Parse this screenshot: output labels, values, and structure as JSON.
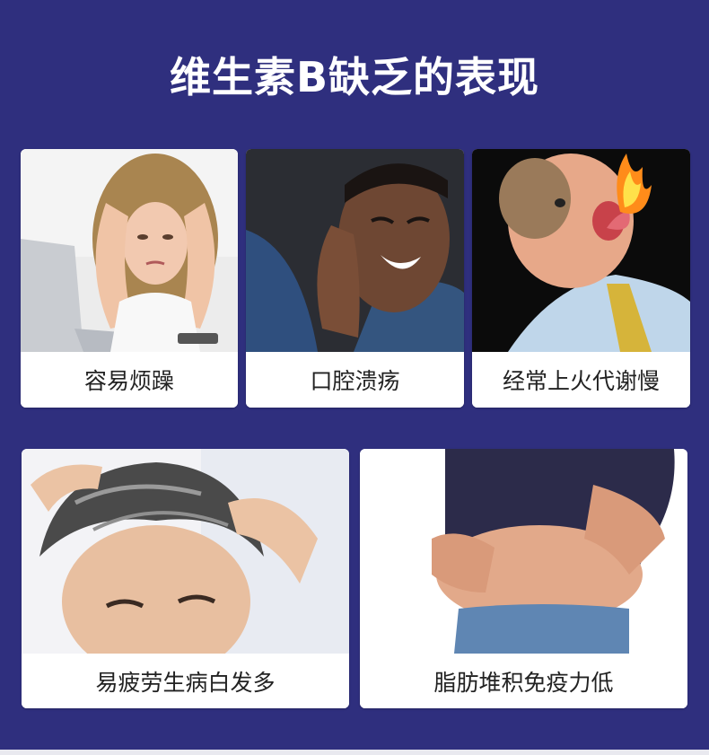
{
  "title": "维生素B缺乏的表现",
  "cards": [
    {
      "caption": "容易烦躁",
      "image": "stressed-woman-at-laptop"
    },
    {
      "caption": "口腔溃疡",
      "image": "man-holding-cheek-in-pain"
    },
    {
      "caption": "经常上火代谢慢",
      "image": "man-breathing-fire"
    },
    {
      "caption": "易疲劳生病白发多",
      "image": "man-with-gray-hair"
    },
    {
      "caption": "脂肪堆积免疫力低",
      "image": "man-holding-belly"
    }
  ],
  "colors": {
    "background": "#2f2f7e",
    "card": "#ffffff",
    "caption_text": "#222222",
    "title_text": "#ffffff"
  }
}
